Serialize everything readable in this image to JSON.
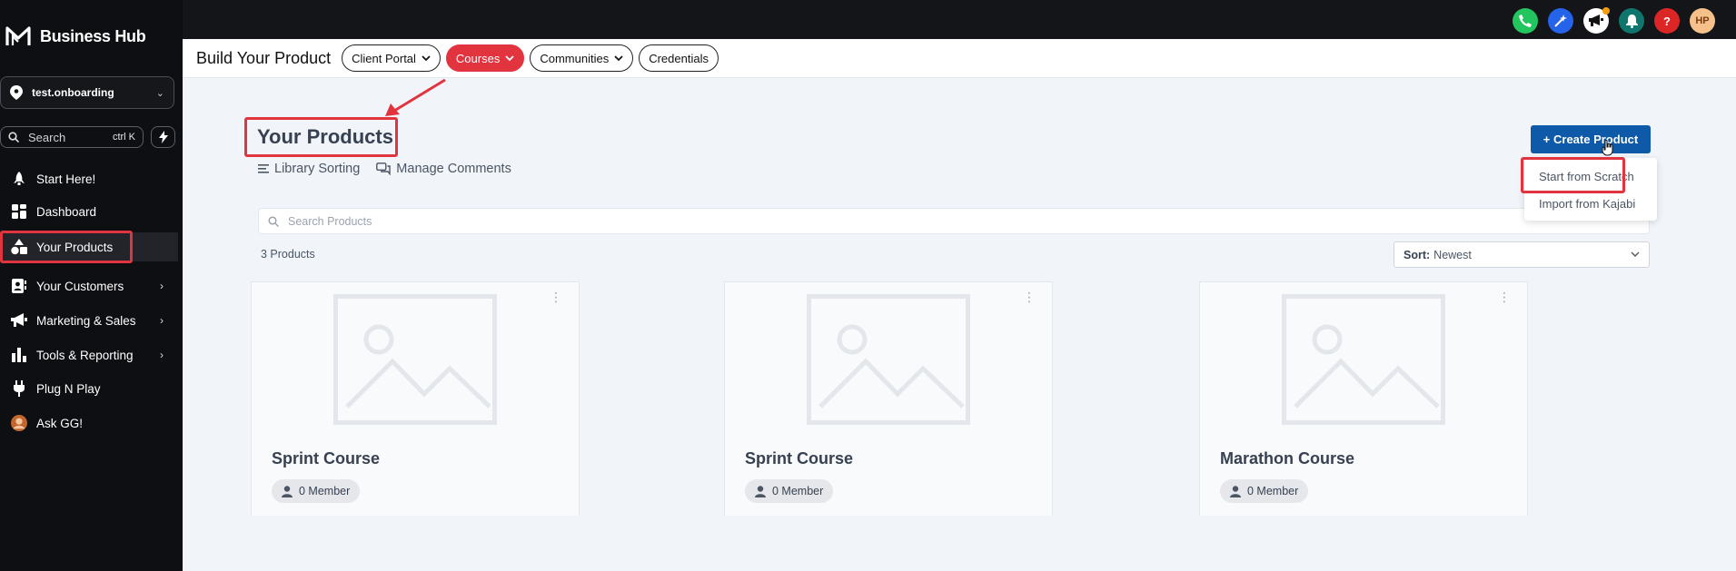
{
  "sidebar": {
    "brand": "Business Hub",
    "location": "test.onboarding",
    "search": {
      "placeholder": "Search",
      "shortcut": "ctrl K"
    },
    "items": [
      {
        "label": "Start Here!",
        "icon": "rocket-icon"
      },
      {
        "label": "Dashboard",
        "icon": "dashboard-icon"
      },
      {
        "label": "Your Products",
        "icon": "shapes-icon",
        "active": true
      },
      {
        "label": "Your Customers",
        "icon": "contacts-icon",
        "has_children": true
      },
      {
        "label": "Marketing & Sales",
        "icon": "megaphone-icon",
        "has_children": true
      },
      {
        "label": "Tools & Reporting",
        "icon": "bar-chart-icon",
        "has_children": true
      },
      {
        "label": "Plug N Play",
        "icon": "plug-icon"
      },
      {
        "label": "Ask GG!",
        "icon": "avatar-icon"
      }
    ]
  },
  "topbar": {
    "icons": [
      {
        "name": "phone-icon",
        "color": "#22c55e"
      },
      {
        "name": "sparkle-icon",
        "color": "#2563eb"
      },
      {
        "name": "megaphone-icon",
        "color": "#ffffff"
      },
      {
        "name": "bell-icon",
        "color": "#0f766e"
      },
      {
        "name": "help-icon",
        "color": "#dc2626",
        "glyph": "?"
      }
    ],
    "avatar_initials": "HP"
  },
  "subheader": {
    "title": "Build Your Product",
    "tabs": [
      {
        "label": "Client Portal",
        "dropdown": true
      },
      {
        "label": "Courses",
        "dropdown": true,
        "active": true
      },
      {
        "label": "Communities",
        "dropdown": true
      },
      {
        "label": "Credentials",
        "dropdown": false
      }
    ]
  },
  "main": {
    "title": "Your Products",
    "links": {
      "library_sorting": "Library Sorting",
      "manage_comments": "Manage Comments"
    },
    "search_placeholder": "Search Products",
    "count": "3 Products",
    "sort": {
      "label": "Sort:",
      "value": "Newest"
    },
    "create_button": "+ Create Product",
    "create_menu": [
      "Start from Scratch",
      "Import from Kajabi"
    ],
    "products": [
      {
        "title": "Sprint Course",
        "members": "0 Member"
      },
      {
        "title": "Sprint Course",
        "members": "0 Member"
      },
      {
        "title": "Marathon Course",
        "members": "0 Member"
      }
    ]
  },
  "colors": {
    "accent": "#e2343e",
    "primary": "#0f5aa8",
    "sidebar": "#0e0f12"
  }
}
